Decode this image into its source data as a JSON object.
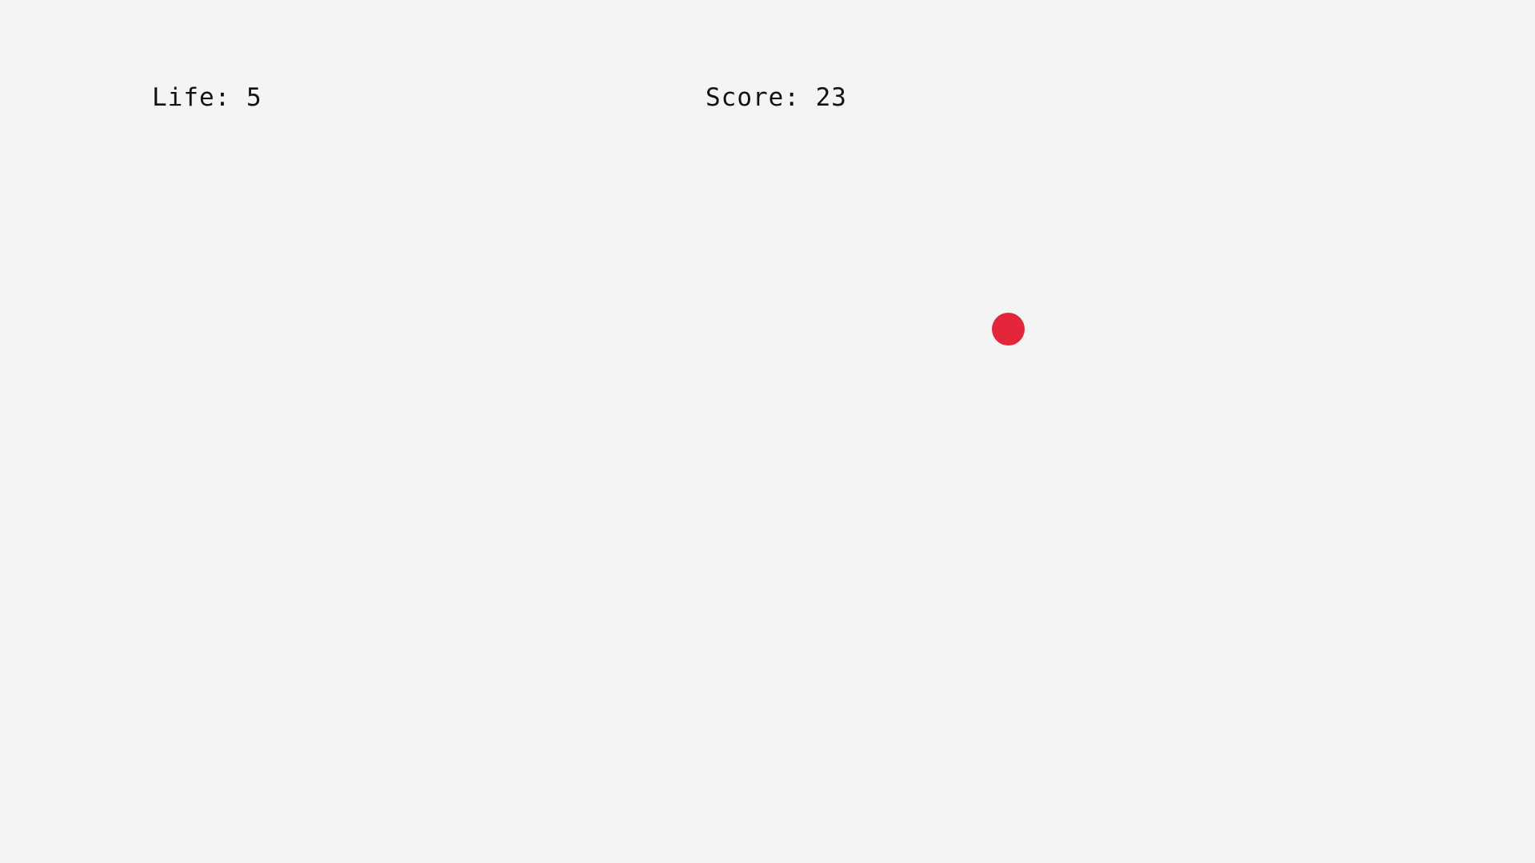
{
  "hud": {
    "life_text": "Life: 5",
    "score_text": "Score: 23"
  },
  "game": {
    "background_color": "#f4f4f4",
    "target_color": "#e3263a",
    "target_shape": "circle"
  }
}
